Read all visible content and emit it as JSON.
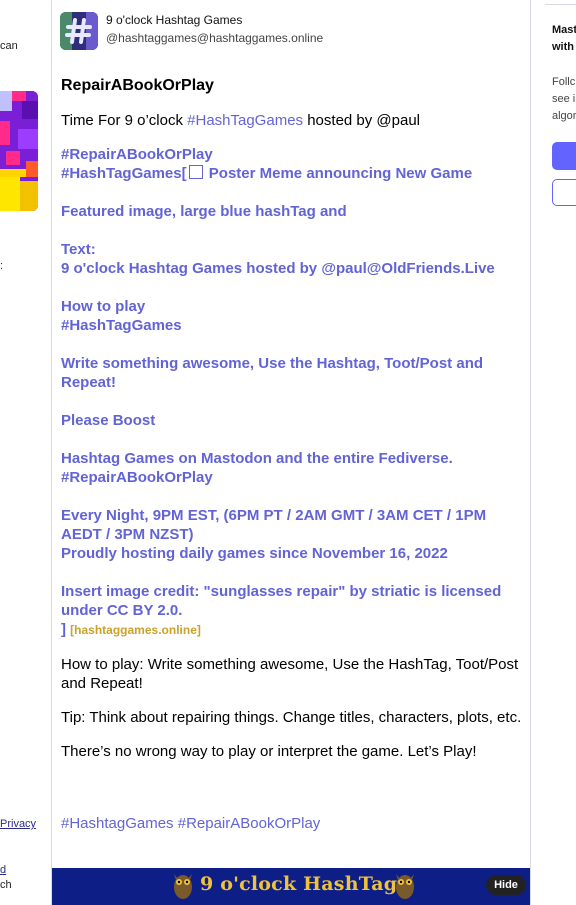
{
  "left": {
    "text_top": "can",
    "text_colon": ":",
    "privacy": "Privacy",
    "text_bottom1": "d",
    "text_bottom2": "ch"
  },
  "post": {
    "author_display": "9 o'clock Hashtag Games",
    "author_handle": "@hashtaggames@hashtaggames.online",
    "title": "RepairABookOrPlay",
    "intro_prefix": "Time For 9 o’clock ",
    "intro_tag": "#HashTagGames",
    "intro_suffix": " hosted by @paul",
    "line_tag1": "#RepairABookOrPlay",
    "line_tag2": "#HashTagGames[",
    "line_tag2_suffix": "  Poster Meme announcing New Game",
    "featured": "Featured image, large blue hashTag and",
    "text_label": "Text:",
    "text_line": " 9 o'clock Hashtag  Games hosted by @paul@OldFriends.Live",
    "howto": "How to play",
    "howto_tag": "#HashTagGames",
    "write": " Write something awesome, Use the Hashtag, Toot/Post and Repeat!",
    "boost": "Please Boost",
    "fediverse1": "Hashtag Games on Mastodon and the entire Fediverse.",
    "fediverse2": "#RepairABookOrPlay",
    "night": "Every Night, 9PM EST, (6PM PT / 2AM GMT / 3AM CET / 1PM AEDT / 3PM  NZST)",
    "since": "Proudly hosting daily games since November 16, 2022",
    "image_credit": "Insert image credit: \"sunglasses repair\" by striatic is licensed under CC BY 2.0.",
    "bracket": "] ",
    "domain_label": "[hashtaggames.online]",
    "how_to_play_full": "How to play: Write something awesome, Use the HashTag, Toot/Post and Repeat!",
    "tip": "Tip: Think about repairing things. Change titles, characters, plots, etc.",
    "no_wrong": "There’s no wrong way to play or interpret the game. Let’s Play!",
    "footer_tag1": "#HashtagGames",
    "footer_tag2": "#RepairABookOrPlay"
  },
  "banner": {
    "text": "9 o'clock HashTags",
    "hide_label": "Hide"
  },
  "right": {
    "heading1": "Mast",
    "heading2": "with",
    "line1": "Follc",
    "line2": "see i",
    "line3": "algor"
  },
  "colors": {
    "accent": "#6364ff",
    "tag": "#6264d6",
    "banner_bg": "#0d1f86",
    "banner_text": "#f0c23a"
  }
}
